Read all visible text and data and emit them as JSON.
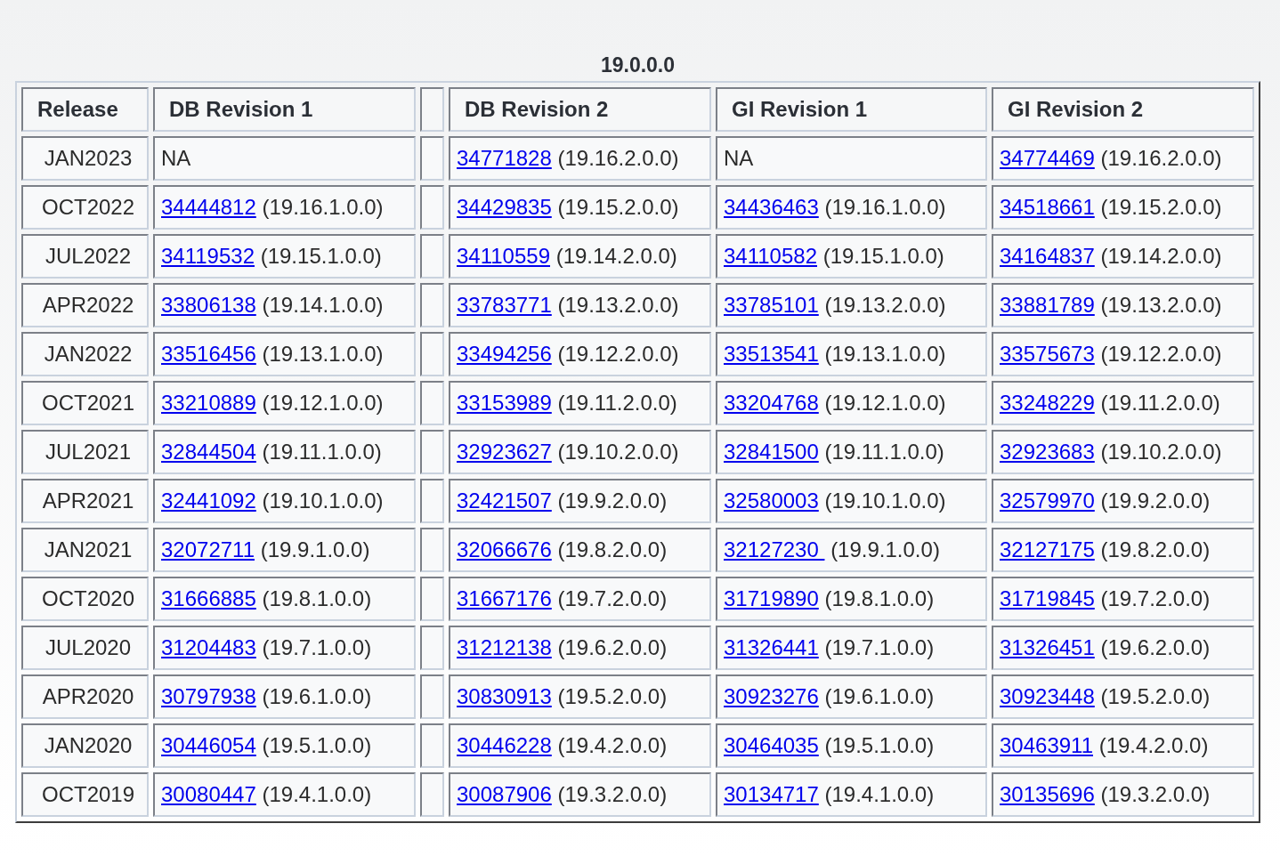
{
  "caption": "19.0.0.0",
  "columns": [
    "Release",
    "DB Revision 1",
    "",
    "DB Revision 2",
    "GI Revision 1",
    "GI Revision 2"
  ],
  "rows": [
    {
      "release": "JAN2023",
      "cells": [
        {
          "kind": "text",
          "text": "NA"
        },
        {
          "kind": "patch",
          "patch": "34771828",
          "version": "(19.16.2.0.0)"
        },
        {
          "kind": "text",
          "text": "NA"
        },
        {
          "kind": "patch",
          "patch": "34774469",
          "version": "(19.16.2.0.0)"
        }
      ]
    },
    {
      "release": "OCT2022",
      "cells": [
        {
          "kind": "patch",
          "patch": "34444812",
          "version": "(19.16.1.0.0)"
        },
        {
          "kind": "patch",
          "patch": "34429835",
          "version": "(19.15.2.0.0)"
        },
        {
          "kind": "patch",
          "patch": "34436463",
          "version": "(19.16.1.0.0)"
        },
        {
          "kind": "patch",
          "patch": "34518661",
          "version": "(19.15.2.0.0)"
        }
      ]
    },
    {
      "release": "JUL2022",
      "cells": [
        {
          "kind": "patch",
          "patch": "34119532",
          "version": "(19.15.1.0.0)"
        },
        {
          "kind": "patch",
          "patch": "34110559",
          "version": "(19.14.2.0.0)"
        },
        {
          "kind": "patch",
          "patch": "34110582",
          "version": "(19.15.1.0.0)"
        },
        {
          "kind": "patch",
          "patch": "34164837",
          "version": "(19.14.2.0.0)"
        }
      ]
    },
    {
      "release": "APR2022",
      "cells": [
        {
          "kind": "patch",
          "patch": "33806138",
          "version": "(19.14.1.0.0)"
        },
        {
          "kind": "patch",
          "patch": "33783771",
          "version": "(19.13.2.0.0)"
        },
        {
          "kind": "patch",
          "patch": "33785101",
          "version": "(19.13.2.0.0)"
        },
        {
          "kind": "patch",
          "patch": "33881789",
          "version": "(19.13.2.0.0)"
        }
      ]
    },
    {
      "release": "JAN2022",
      "cells": [
        {
          "kind": "patch",
          "patch": "33516456",
          "version": "(19.13.1.0.0)"
        },
        {
          "kind": "patch",
          "patch": "33494256",
          "version": "(19.12.2.0.0)"
        },
        {
          "kind": "patch",
          "patch": "33513541",
          "version": "(19.13.1.0.0)"
        },
        {
          "kind": "patch",
          "patch": "33575673",
          "version": "(19.12.2.0.0)"
        }
      ]
    },
    {
      "release": "OCT2021",
      "cells": [
        {
          "kind": "patch",
          "patch": "33210889",
          "version": "(19.12.1.0.0)"
        },
        {
          "kind": "patch",
          "patch": "33153989",
          "version": "(19.11.2.0.0)"
        },
        {
          "kind": "patch",
          "patch": "33204768",
          "version": "(19.12.1.0.0)"
        },
        {
          "kind": "patch",
          "patch": "33248229",
          "version": "(19.11.2.0.0)"
        }
      ]
    },
    {
      "release": "JUL2021",
      "cells": [
        {
          "kind": "patch",
          "patch": "32844504",
          "version": "(19.11.1.0.0)"
        },
        {
          "kind": "patch",
          "patch": "32923627",
          "version": "(19.10.2.0.0)"
        },
        {
          "kind": "patch",
          "patch": "32841500",
          "version": "(19.11.1.0.0)"
        },
        {
          "kind": "patch",
          "patch": "32923683",
          "version": "(19.10.2.0.0)"
        }
      ]
    },
    {
      "release": "APR2021",
      "cells": [
        {
          "kind": "patch",
          "patch": "32441092",
          "version": "(19.10.1.0.0)"
        },
        {
          "kind": "patch",
          "patch": "32421507",
          "version": "(19.9.2.0.0)"
        },
        {
          "kind": "patch",
          "patch": "32580003",
          "version": "(19.10.1.0.0)"
        },
        {
          "kind": "patch",
          "patch": "32579970",
          "version": "(19.9.2.0.0)"
        }
      ]
    },
    {
      "release": "JAN2021",
      "cells": [
        {
          "kind": "patch",
          "patch": "32072711",
          "version": "(19.9.1.0.0)"
        },
        {
          "kind": "patch",
          "patch": "32066676",
          "version": "(19.8.2.0.0)"
        },
        {
          "kind": "patch",
          "patch": "32127230 ",
          "version": "(19.9.1.0.0)"
        },
        {
          "kind": "patch",
          "patch": "32127175",
          "version": "(19.8.2.0.0)"
        }
      ]
    },
    {
      "release": "OCT2020",
      "cells": [
        {
          "kind": "patch",
          "patch": "31666885",
          "version": "(19.8.1.0.0)"
        },
        {
          "kind": "patch",
          "patch": "31667176",
          "version": "(19.7.2.0.0)"
        },
        {
          "kind": "patch",
          "patch": "31719890",
          "version": "(19.8.1.0.0)"
        },
        {
          "kind": "patch",
          "patch": "31719845",
          "version": "(19.7.2.0.0)"
        }
      ]
    },
    {
      "release": "JUL2020",
      "cells": [
        {
          "kind": "patch",
          "patch": "31204483",
          "version": "(19.7.1.0.0)"
        },
        {
          "kind": "patch",
          "patch": "31212138",
          "version": "(19.6.2.0.0)"
        },
        {
          "kind": "patch",
          "patch": "31326441",
          "version": "(19.7.1.0.0)"
        },
        {
          "kind": "patch",
          "patch": "31326451",
          "version": "(19.6.2.0.0)"
        }
      ]
    },
    {
      "release": "APR2020",
      "cells": [
        {
          "kind": "patch",
          "patch": "30797938",
          "version": "(19.6.1.0.0)"
        },
        {
          "kind": "patch",
          "patch": "30830913",
          "version": "(19.5.2.0.0)"
        },
        {
          "kind": "patch",
          "patch": "30923276",
          "version": "(19.6.1.0.0)"
        },
        {
          "kind": "patch",
          "patch": "30923448",
          "version": "(19.5.2.0.0)"
        }
      ]
    },
    {
      "release": "JAN2020",
      "cells": [
        {
          "kind": "patch",
          "patch": "30446054",
          "version": "(19.5.1.0.0)"
        },
        {
          "kind": "patch",
          "patch": "30446228",
          "version": "(19.4.2.0.0)"
        },
        {
          "kind": "patch",
          "patch": "30464035",
          "version": "(19.5.1.0.0)"
        },
        {
          "kind": "patch",
          "patch": "30463911",
          "version": "(19.4.2.0.0)"
        }
      ]
    },
    {
      "release": "OCT2019",
      "cells": [
        {
          "kind": "patch",
          "patch": "30080447",
          "version": "(19.4.1.0.0)"
        },
        {
          "kind": "patch",
          "patch": "30087906",
          "version": "(19.3.2.0.0)"
        },
        {
          "kind": "patch",
          "patch": "30134717",
          "version": "(19.4.1.0.0)"
        },
        {
          "kind": "patch",
          "patch": "30135696",
          "version": "(19.3.2.0.0)"
        }
      ]
    }
  ]
}
